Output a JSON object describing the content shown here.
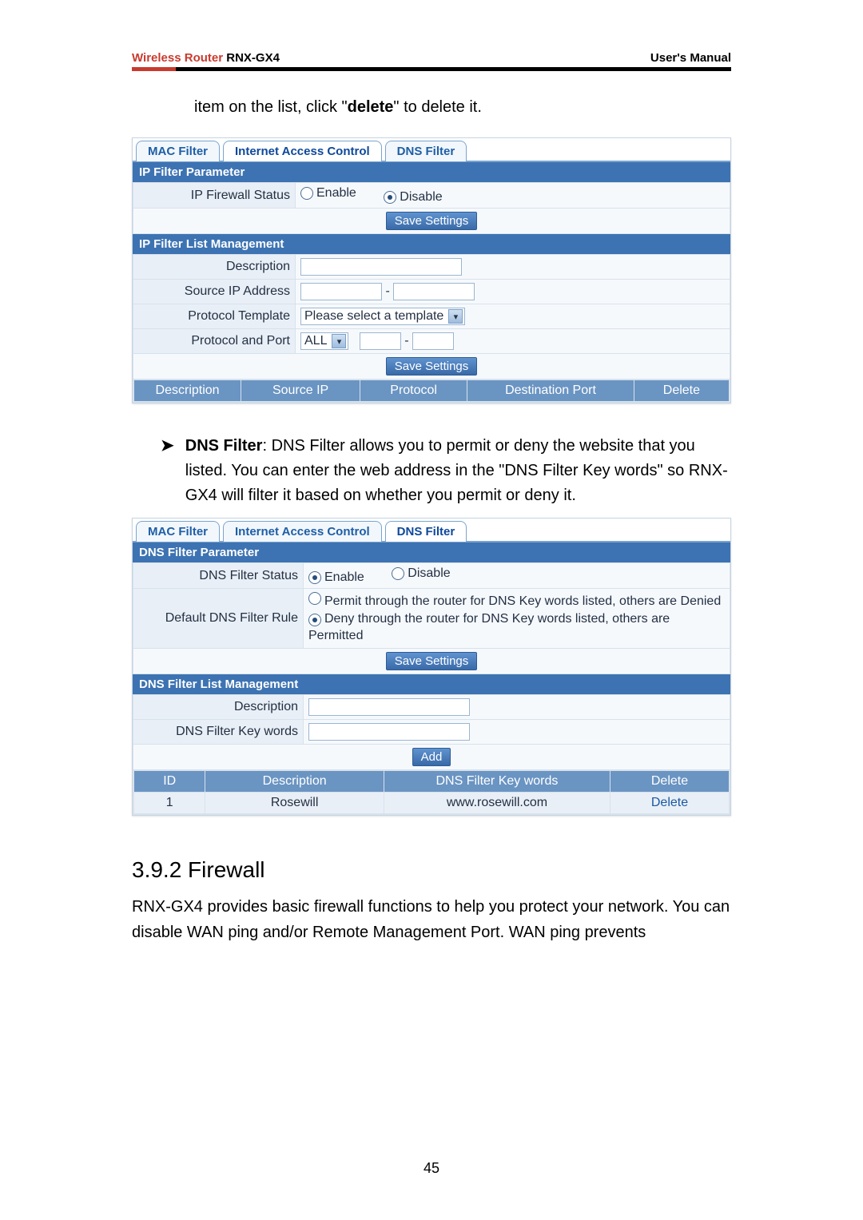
{
  "doc": {
    "brand": "Wireless Router",
    "model": "RNX-GX4",
    "manual": "User's Manual",
    "pageNum": "45"
  },
  "intro": {
    "pre": "item on the list, click \"",
    "bold": "delete",
    "post": "\" to delete it."
  },
  "card1": {
    "tabs": [
      "MAC Filter",
      "Internet Access Control",
      "DNS Filter"
    ],
    "activeTab": 1,
    "sec1": "IP Filter Parameter",
    "row_status_label": "IP Firewall Status",
    "enable": "Enable",
    "disable": "Disable",
    "save": "Save Settings",
    "sec2": "IP Filter List Management",
    "r_desc": "Description",
    "r_src": "Source IP Address",
    "r_pt": "Protocol Template",
    "pt_value": "Please select a template",
    "r_pp": "Protocol and Port",
    "pp_value": "ALL",
    "dash": "-",
    "list_headers": [
      "Description",
      "Source IP",
      "Protocol",
      "Destination Port",
      "Delete"
    ]
  },
  "dnsText": {
    "lead": "DNS Filter",
    "body": ": DNS Filter allows you to permit or deny the website that you listed. You can enter the web address in the \"DNS Filter Key words\" so RNX-GX4 will filter it based on whether you permit or deny it."
  },
  "card2": {
    "tabs": [
      "MAC Filter",
      "Internet Access Control",
      "DNS Filter"
    ],
    "activeTab": 2,
    "sec1": "DNS Filter Parameter",
    "row_status_label": "DNS Filter Status",
    "enable": "Enable",
    "disable": "Disable",
    "row_rule_label": "Default DNS Filter Rule",
    "opt_permit": "Permit through the router for DNS Key words listed, others are Denied",
    "opt_deny": "Deny through the router for DNS Key words listed, others are Permitted",
    "save": "Save Settings",
    "sec2": "DNS Filter List Management",
    "r_desc": "Description",
    "r_key": "DNS Filter Key words",
    "add": "Add",
    "list_headers": [
      "ID",
      "Description",
      "DNS Filter Key words",
      "Delete"
    ],
    "row": {
      "id": "1",
      "desc": "Rosewill",
      "key": "www.rosewill.com",
      "del": "Delete"
    }
  },
  "sectionHeading": "3.9.2 Firewall",
  "sectionBody": "RNX-GX4 provides basic firewall functions to help you protect your network. You can disable WAN ping and/or Remote Management Port. WAN ping prevents"
}
